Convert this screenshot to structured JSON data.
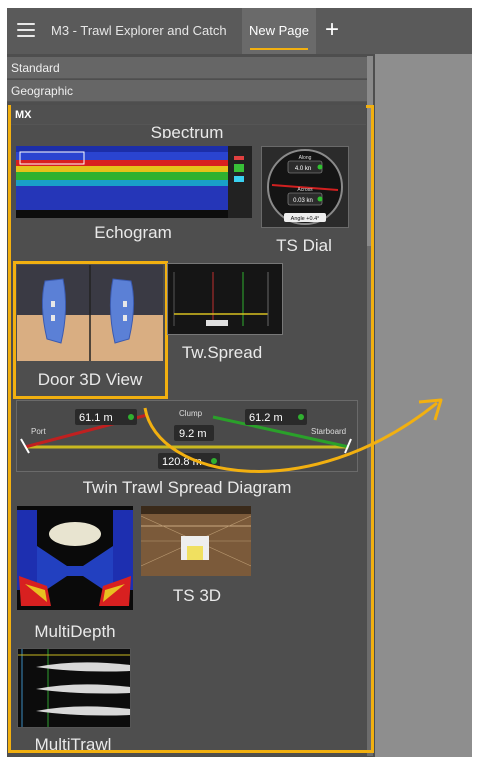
{
  "topbar": {
    "tab_first": "M3 - Trawl Explorer and Catch",
    "tab_active": "New Page",
    "add_label": "+"
  },
  "sections": {
    "standard": "Standard",
    "geographic": "Geographic",
    "mx": "MX"
  },
  "items": {
    "spectrum": "Spectrum",
    "echogram": "Echogram",
    "ts_dial": "TS Dial",
    "door_3d_view": "Door 3D View",
    "tw_spread": "Tw.Spread",
    "twin_trawl_spread_diagram": "Twin Trawl Spread Diagram",
    "ts_3d": "TS 3D",
    "multidepth": "MultiDepth",
    "multitrawl": "MultiTrawl"
  },
  "ts_dial_values": {
    "along_label": "Along",
    "along_value": "4.0 kn",
    "across_label": "Across",
    "across_value": "0.03 kn",
    "angle_value": "Angle +0.4°"
  },
  "twin_spread": {
    "port_label": "Port",
    "starboard_label": "Starboard",
    "clump_label": "Clump",
    "left_value": "61.1 m",
    "right_value": "61.2 m",
    "clump_value": "9.2 m",
    "total_value": "120.8 m"
  },
  "colors": {
    "accent": "#f2b010",
    "panel": "#4e4e4e",
    "topbar": "#5a5a5a"
  }
}
